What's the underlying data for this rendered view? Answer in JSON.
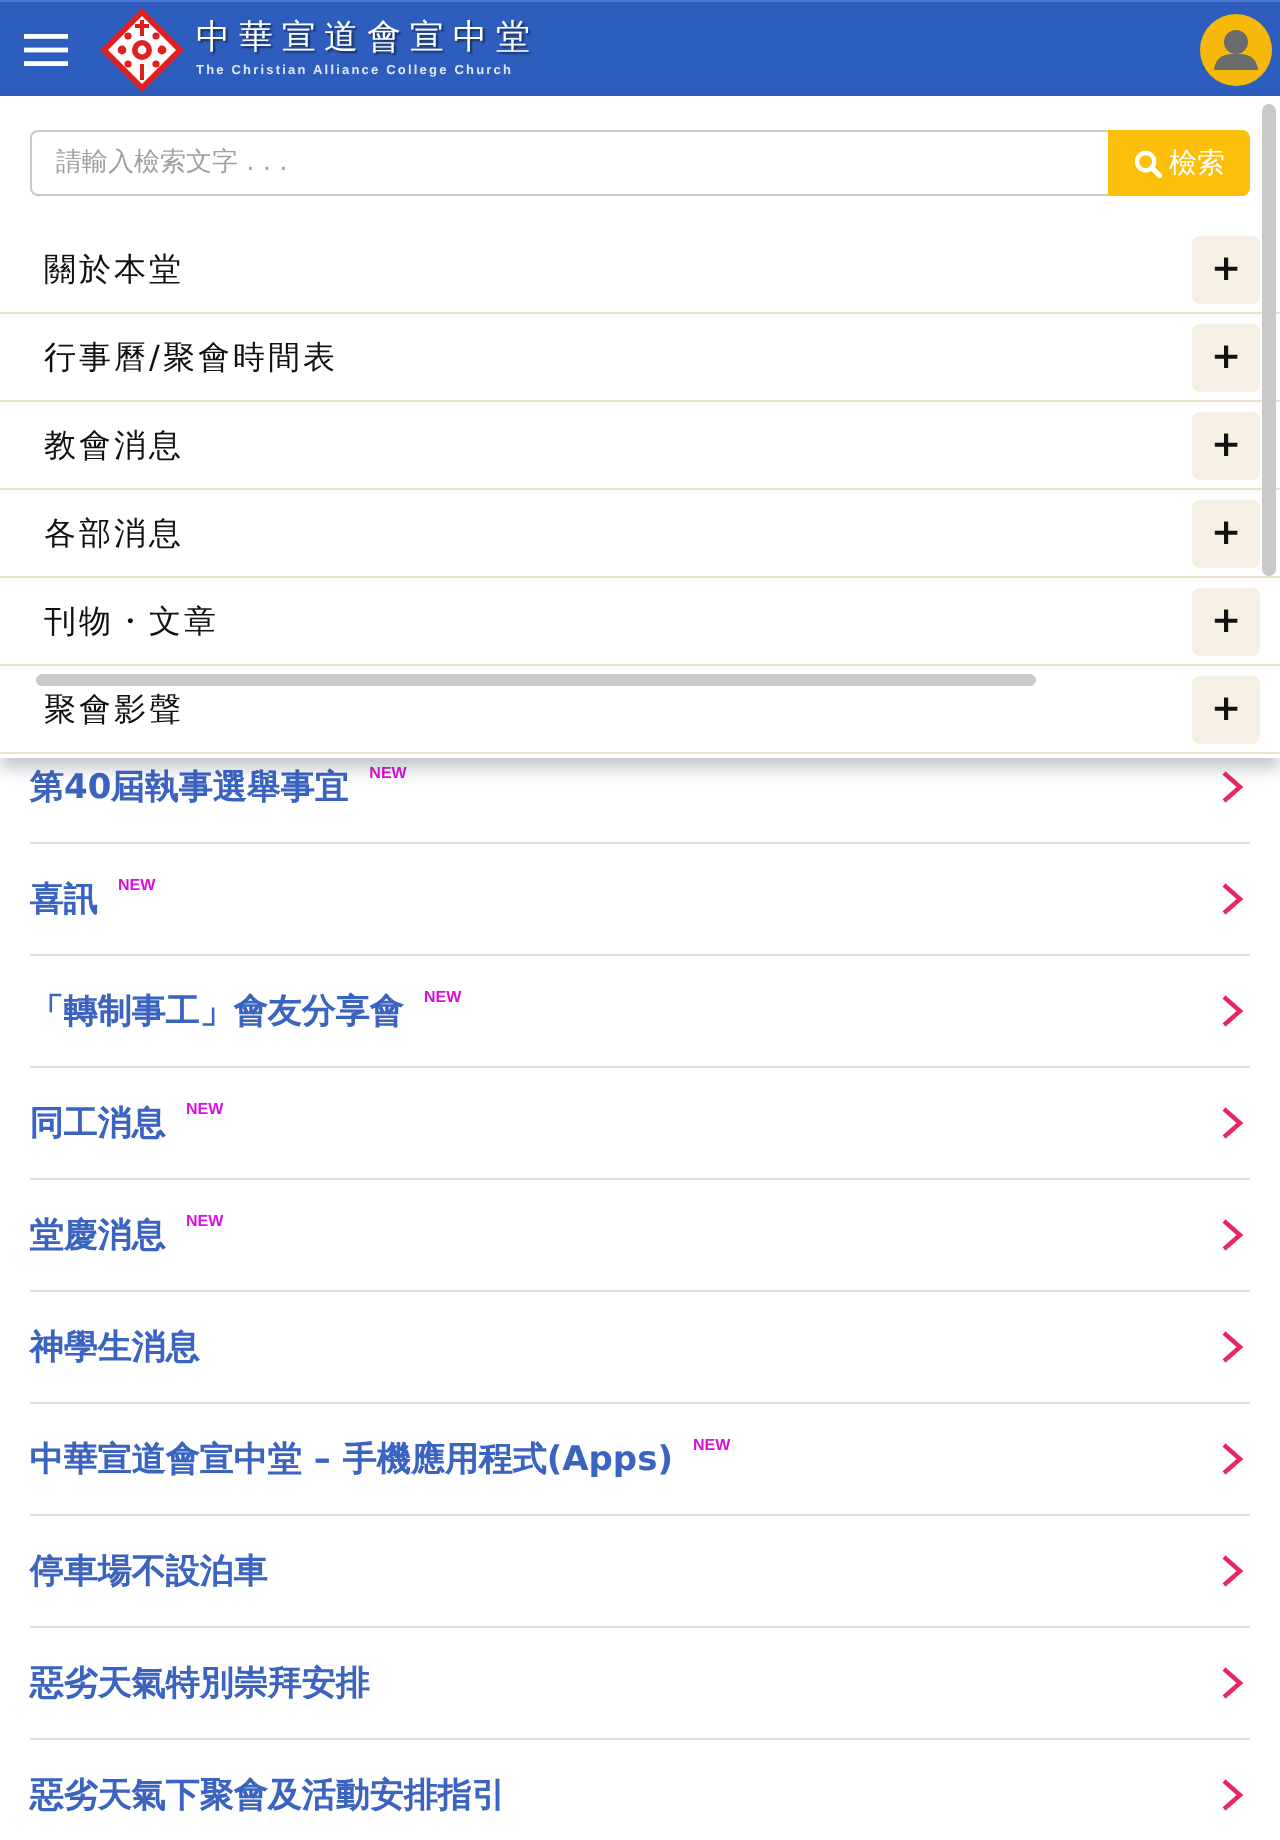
{
  "header": {
    "title": "中華宣道會宣中堂",
    "subtitle": "The Christian Alliance College Church"
  },
  "menu_panel": {
    "search": {
      "placeholder": "請輸入檢索文字 . . .",
      "button": "檢索"
    },
    "items": [
      {
        "label": "關於本堂",
        "toggle": "+"
      },
      {
        "label": "行事曆/聚會時間表",
        "toggle": "+"
      },
      {
        "label": "教會消息",
        "toggle": "+"
      },
      {
        "label": "各部消息",
        "toggle": "+"
      },
      {
        "label": "刊物・文章",
        "toggle": "+"
      },
      {
        "label": "聚會影聲",
        "toggle": "+"
      }
    ]
  },
  "news": [
    {
      "title": "第40屆執事選舉事宜",
      "badge": "NEW"
    },
    {
      "title": "喜訊",
      "badge": "NEW"
    },
    {
      "title": "「轉制事工」會友分享會",
      "badge": "NEW"
    },
    {
      "title": "同工消息",
      "badge": "NEW"
    },
    {
      "title": "堂慶消息",
      "badge": "NEW"
    },
    {
      "title": "神學生消息"
    },
    {
      "title": "中華宣道會宣中堂 – 手機應用程式(Apps)",
      "badge": "NEW"
    },
    {
      "title": "停車場不設泊車"
    },
    {
      "title": "惡劣天氣特別崇拜安排"
    },
    {
      "title": "惡劣天氣下聚會及活動安排指引"
    }
  ]
}
